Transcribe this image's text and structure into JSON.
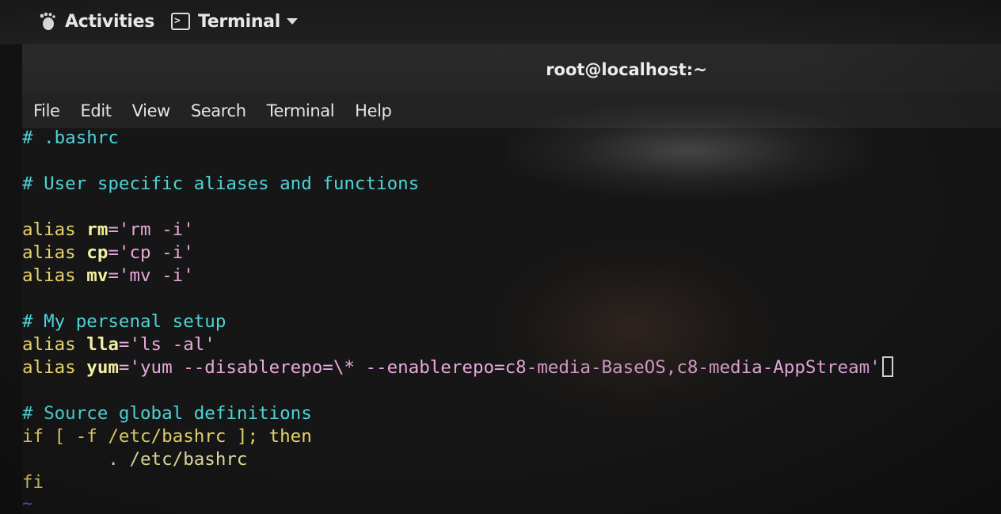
{
  "topbar": {
    "activities_label": "Activities",
    "app_menu_label": "Terminal",
    "activities_icon": "gnome-foot-icon",
    "app_icon": "terminal-icon",
    "caret_icon": "caret-down-icon"
  },
  "window": {
    "title": "root@localhost:~"
  },
  "menubar": {
    "items": [
      "File",
      "Edit",
      "View",
      "Search",
      "Terminal",
      "Help"
    ]
  },
  "terminal": {
    "lines": {
      "l1": "# .bashrc",
      "l2": "# User specific aliases and functions",
      "l3_kw": "alias",
      "l3_name": "rm",
      "l3_val": "='rm -i'",
      "l4_kw": "alias",
      "l4_name": "cp",
      "l4_val": "='cp -i'",
      "l5_kw": "alias",
      "l5_name": "mv",
      "l5_val": "='mv -i'",
      "l6": "# My persenal setup",
      "l7_kw": "alias",
      "l7_name": "lla",
      "l7_val": "='ls -al'",
      "l8_kw": "alias",
      "l8_name": "yum",
      "l8_val": "='yum --disablerepo=\\* --enablerepo=c8-media-BaseOS,c8-media-AppStream'",
      "l9": "# Source global definitions",
      "l10": "if [ -f /etc/bashrc ]; then",
      "l11": "        . /etc/bashrc",
      "l12": "fi",
      "l13": "~"
    },
    "colors": {
      "comment": "#4fd3d7",
      "keyword": "#e6d36a",
      "string": "#e7a9dd",
      "background": "#161616"
    }
  }
}
